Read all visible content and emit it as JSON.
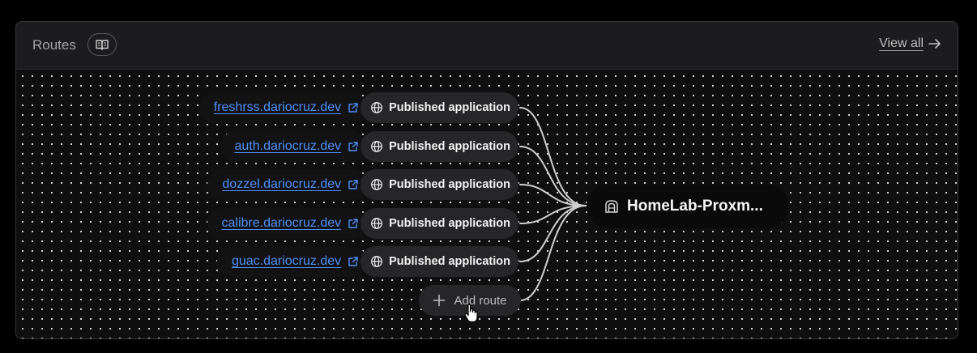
{
  "header": {
    "title": "Routes",
    "docs_icon": "book-open-icon",
    "view_all_label": "View all",
    "view_all_icon": "arrow-right-icon"
  },
  "routes": [
    {
      "hostname": "freshrss.dariocruz.dev",
      "type_label": "Published application"
    },
    {
      "hostname": "auth.dariocruz.dev",
      "type_label": "Published application"
    },
    {
      "hostname": "dozzel.dariocruz.dev",
      "type_label": "Published application"
    },
    {
      "hostname": "calibre.dariocruz.dev",
      "type_label": "Published application"
    },
    {
      "hostname": "guac.dariocruz.dev",
      "type_label": "Published application"
    }
  ],
  "add_route": {
    "label": "Add route",
    "icon": "plus-icon"
  },
  "tunnel": {
    "name": "HomeLab-Proxm...",
    "icon": "tunnel-icon"
  },
  "colors": {
    "link": "#4f8ff7",
    "connector": "#cfcfcf",
    "pill": "#262628",
    "background": "#000000"
  }
}
